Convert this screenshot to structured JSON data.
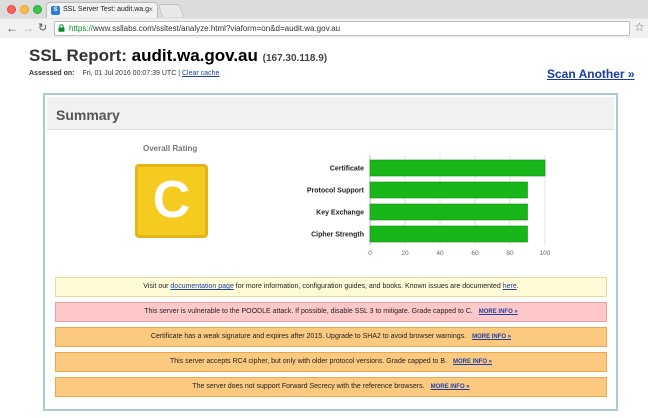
{
  "browser": {
    "tab_title": "SSL Server Test: audit.wa.g",
    "tab_close": "×",
    "url_scheme": "https://",
    "url_rest": "www.ssllabs.com/ssltest/analyze.html?viaform=on&d=audit.wa.gov.au",
    "back_icon": "back-arrow-icon",
    "forward_icon": "forward-arrow-icon",
    "reload_icon": "reload-icon",
    "bookmark_icon": "star-icon"
  },
  "page": {
    "title_prefix": "SSL Report: ",
    "domain": "audit.wa.gov.au",
    "ip": "(167.30.118.9)",
    "assessed_label": "Assessed on:",
    "assessed_value": "Fri, 01 Jul 2016 00:07:39 UTC |",
    "clear_cache": "Clear cache",
    "scan_another": "Scan Another »"
  },
  "summary": {
    "title": "Summary",
    "overall_rating_label": "Overall Rating",
    "grade": "C",
    "grade_color": "#f6cb1f"
  },
  "chart_data": {
    "type": "bar",
    "orientation": "horizontal",
    "categories": [
      "Certificate",
      "Protocol Support",
      "Key Exchange",
      "Cipher Strength"
    ],
    "values": [
      100,
      90,
      90,
      90
    ],
    "xlim": [
      0,
      100
    ],
    "xticks": [
      0,
      20,
      40,
      60,
      80,
      100
    ],
    "bar_color": "#19b619",
    "grid": true
  },
  "notices": [
    {
      "kind": "info",
      "before": "Visit our ",
      "link": "documentation page",
      "middle": " for more information, configuration guides, and books. Known issues are documented ",
      "link2": "here",
      "after": "."
    },
    {
      "kind": "error",
      "text": "This server is vulnerable to the POODLE attack. If possible, disable SSL 3 to mitigate. Grade capped to C.",
      "more": "MORE INFO »"
    },
    {
      "kind": "warning",
      "text": "Certificate has a weak signature and expires after 2015. Upgrade to SHA2 to avoid browser warnings.",
      "more": "MORE INFO »"
    },
    {
      "kind": "warning",
      "text": "This server accepts RC4 cipher, but only with older protocol versions. Grade capped to B.",
      "more": "MORE INFO »"
    },
    {
      "kind": "warning",
      "text": "The server does not support Forward Secrecy with the reference browsers.",
      "more": "MORE INFO »"
    }
  ]
}
